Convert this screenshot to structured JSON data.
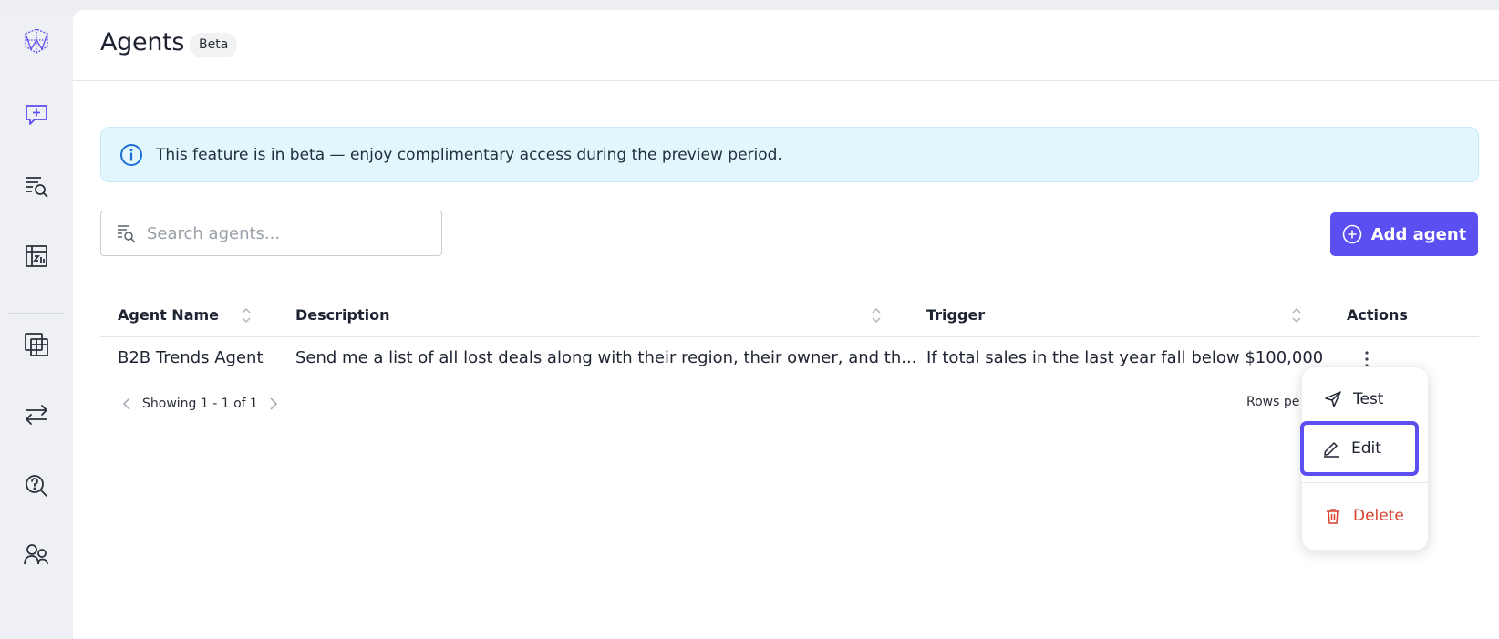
{
  "sidebar": {
    "items": [
      {
        "name": "logo",
        "icon": "network-logo-icon"
      },
      {
        "name": "new-chat",
        "icon": "chat-plus-icon"
      },
      {
        "name": "search-list",
        "icon": "list-search-icon"
      },
      {
        "name": "reports",
        "icon": "chart-table-icon"
      },
      {
        "name": "tables",
        "icon": "stacked-tables-icon"
      },
      {
        "name": "transfers",
        "icon": "arrows-swap-icon"
      },
      {
        "name": "help-search",
        "icon": "question-search-icon"
      },
      {
        "name": "users",
        "icon": "users-icon"
      }
    ]
  },
  "header": {
    "title": "Agents",
    "badge": "Beta"
  },
  "banner": {
    "text": "This feature is in beta — enjoy complimentary access during the preview period."
  },
  "search": {
    "placeholder": "Search agents...",
    "value": ""
  },
  "toolbar": {
    "add_label": "Add agent"
  },
  "table": {
    "columns": [
      "Agent Name",
      "Description",
      "Trigger",
      "Actions"
    ],
    "rows": [
      {
        "name": "B2B Trends Agent",
        "description": "Send me a list of all lost deals along with their region, their owner, and th...",
        "trigger": "If total sales in the last year fall below $100,000"
      }
    ]
  },
  "pagination": {
    "showing": "Showing 1 - 1 of 1",
    "rows_per_page": "Rows pe"
  },
  "menu": {
    "test_label": "Test",
    "edit_label": "Edit",
    "delete_label": "Delete"
  },
  "colors": {
    "accent": "#5b4ff2",
    "banner_bg": "#e1f6fd",
    "danger": "#d9412f"
  }
}
